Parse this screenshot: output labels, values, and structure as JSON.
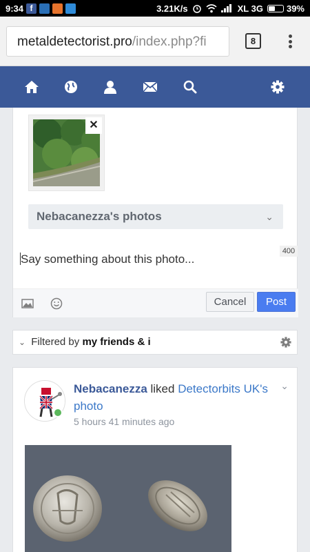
{
  "status_bar": {
    "time": "9:34",
    "network_speed": "3.21K/s",
    "carrier": "XL 3G",
    "battery_percent": "39%",
    "battery_level": 0.39,
    "notification_icons": [
      "facebook-icon",
      "gallery-icon",
      "orange-app-icon",
      "blue-app-icon"
    ]
  },
  "browser": {
    "url_domain": "metaldetectorist.pro",
    "url_path": "/index.php?fi",
    "tab_count": "8"
  },
  "navbar": {
    "icons": [
      "home-icon",
      "globe-icon",
      "user-icon",
      "mail-icon",
      "search-icon",
      "settings-gear-icon"
    ]
  },
  "composer": {
    "album_label": "Nebacanezza's photos",
    "char_counter": "400",
    "caption_placeholder": "Say something about this photo...",
    "cancel_label": "Cancel",
    "post_label": "Post"
  },
  "filter": {
    "prefix": "Filtered by",
    "value": "my friends & i"
  },
  "feed_item": {
    "actor": "Nebacanezza",
    "verb": " liked ",
    "object": "Detectorbits UK's photo",
    "timestamp": "5 hours 41 minutes ago"
  },
  "colors": {
    "navbar": "#3b5998",
    "post_button": "#4a7cf0",
    "link": "#3b78c8",
    "online": "#5cb85c"
  }
}
